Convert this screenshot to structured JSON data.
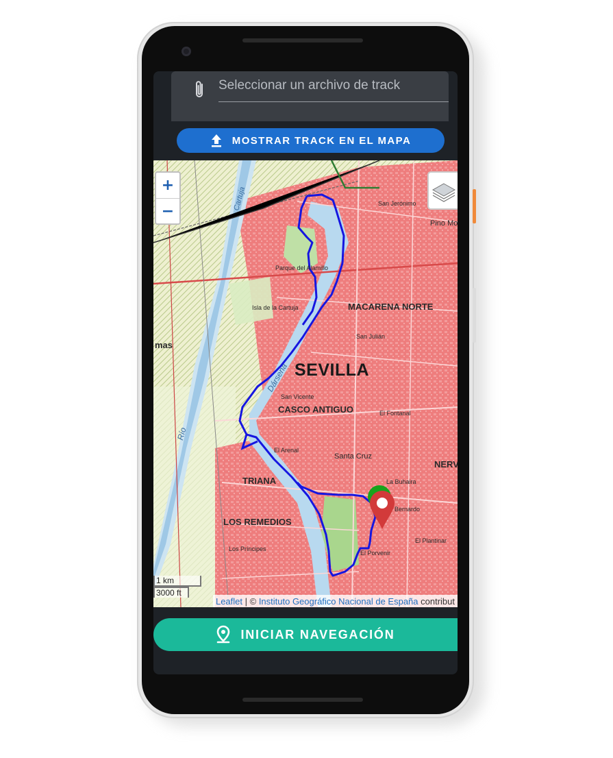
{
  "file_picker": {
    "icon": "paperclip-icon",
    "placeholder": "Seleccionar un archivo de track"
  },
  "show_track_button": {
    "icon": "upload-icon",
    "label": "MOSTRAR TRACK EN EL MAPA",
    "color": "#1e6fcf"
  },
  "map": {
    "zoom_in": "+",
    "zoom_out": "−",
    "layers_icon": "layers-icon",
    "labels": {
      "sevilla": "SEVILLA",
      "casco_antiguo": "CASCO ANTIGUO",
      "macarena_norte": "MACARENA NORTE",
      "triana": "TRIANA",
      "los_remedios": "LOS REMEDIOS",
      "santa_cruz": "Santa Cruz",
      "el_arenal": "El Arenal",
      "el_porvenir": "El Porvenir",
      "san_jeronimo": "San Jerónimo",
      "isla_cartuja": "Isla de la Cartuja",
      "parque_alamillo": "Parque del Alamillo",
      "nerv": "NERV",
      "mas": "mas",
      "san_bernardo": "Bernardo",
      "los_principes": "Los Príncipes",
      "san_vicente": "San Vicente",
      "san_julian": "San Julián",
      "el_fontanal": "El Fontanal",
      "la_buhaira": "La Buhaira",
      "el_plantinar": "El Plantinar",
      "pino_mo": "Pino Mo",
      "rio": "Río",
      "cartuja": "Cartuja",
      "dársena": "Dársena"
    },
    "scale": {
      "metric": "1 km",
      "imperial": "3000 ft"
    },
    "attribution": {
      "leaflet": "Leaflet",
      "separator": " | © ",
      "ign": "Instituto Geográfico Nacional de España",
      "tail": " contribut"
    },
    "track_color": "#1616e0",
    "start_marker_color": "#18a31c",
    "end_marker_color": "#d23a3a"
  },
  "navigation_button": {
    "icon": "location-pin-icon",
    "label": "INICIAR NAVEGACIÓN",
    "color": "#1bb99a"
  }
}
